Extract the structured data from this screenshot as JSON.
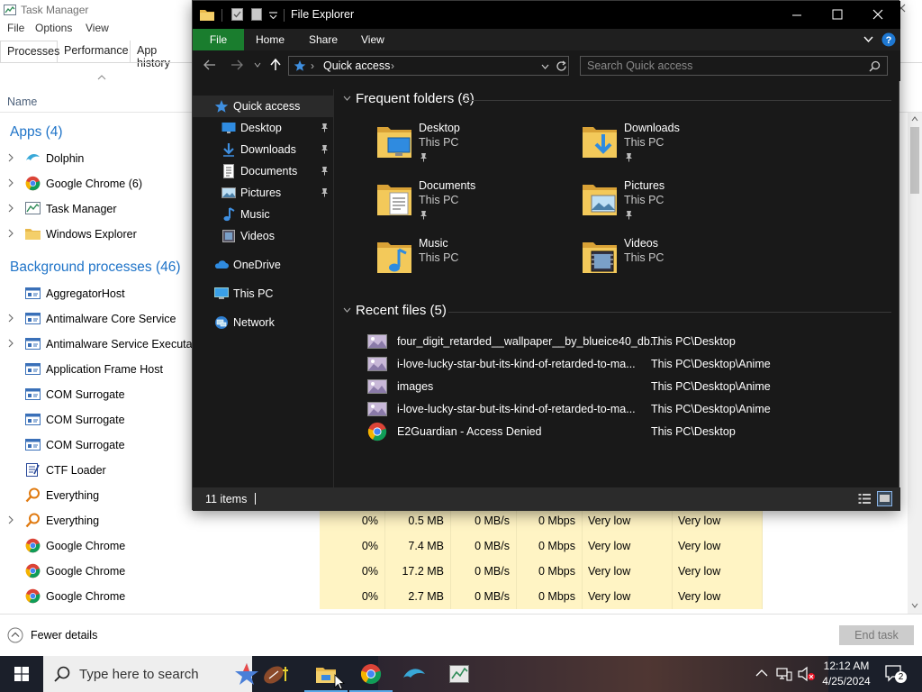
{
  "task_manager": {
    "title": "Task Manager",
    "menu": [
      "File",
      "Options",
      "View"
    ],
    "tabs": [
      "Processes",
      "Performance",
      "App history"
    ],
    "name_column": "Name",
    "apps_heading": "Apps (4)",
    "apps": [
      {
        "name": "Dolphin",
        "icon": "dolphin-icon",
        "expandable": true
      },
      {
        "name": "Google Chrome (6)",
        "icon": "chrome-icon",
        "expandable": true
      },
      {
        "name": "Task Manager",
        "icon": "task-manager-icon",
        "expandable": true
      },
      {
        "name": "Windows Explorer",
        "icon": "folder-icon",
        "expandable": true
      }
    ],
    "background_heading": "Background processes (46)",
    "background": [
      {
        "name": "AggregatorHost",
        "icon": "service-icon",
        "expandable": false
      },
      {
        "name": "Antimalware Core Service",
        "icon": "service-icon",
        "expandable": true
      },
      {
        "name": "Antimalware Service Executable",
        "icon": "service-icon",
        "expandable": true
      },
      {
        "name": "Application Frame Host",
        "icon": "service-icon",
        "expandable": false
      },
      {
        "name": "COM Surrogate",
        "icon": "service-icon",
        "expandable": false
      },
      {
        "name": "COM Surrogate",
        "icon": "service-icon",
        "expandable": false
      },
      {
        "name": "COM Surrogate",
        "icon": "service-icon",
        "expandable": false
      },
      {
        "name": "CTF Loader",
        "icon": "ctf-icon",
        "expandable": false
      },
      {
        "name": "Everything",
        "icon": "everything-icon",
        "expandable": false
      },
      {
        "name": "Everything",
        "icon": "everything-icon",
        "expandable": true,
        "metrics": [
          "0%",
          "0.5 MB",
          "0 MB/s",
          "0 Mbps",
          "Very low",
          "Very low"
        ]
      },
      {
        "name": "Google Chrome",
        "icon": "chrome-icon",
        "expandable": false,
        "metrics": [
          "0%",
          "7.4 MB",
          "0 MB/s",
          "0 Mbps",
          "Very low",
          "Very low"
        ]
      },
      {
        "name": "Google Chrome",
        "icon": "chrome-icon",
        "expandable": false,
        "metrics": [
          "0%",
          "17.2 MB",
          "0 MB/s",
          "0 Mbps",
          "Very low",
          "Very low"
        ]
      },
      {
        "name": "Google Chrome",
        "icon": "chrome-icon",
        "expandable": false,
        "metrics": [
          "0%",
          "2.7 MB",
          "0 MB/s",
          "0 Mbps",
          "Very low",
          "Very low"
        ]
      }
    ],
    "fewer_details": "Fewer details",
    "end_task": "End task"
  },
  "explorer": {
    "title": "File Explorer",
    "ribbon_tabs": [
      "File",
      "Home",
      "Share",
      "View"
    ],
    "address": "Quick access",
    "search_placeholder": "Search Quick access",
    "nav": [
      {
        "label": "Quick access",
        "icon": "star-icon",
        "pinned": false,
        "indent": 1,
        "selected": true
      },
      {
        "label": "Desktop",
        "icon": "desktop-icon",
        "pinned": true,
        "indent": 2
      },
      {
        "label": "Downloads",
        "icon": "download-icon",
        "pinned": true,
        "indent": 2
      },
      {
        "label": "Documents",
        "icon": "document-icon",
        "pinned": true,
        "indent": 2
      },
      {
        "label": "Pictures",
        "icon": "pictures-icon",
        "pinned": true,
        "indent": 2
      },
      {
        "label": "Music",
        "icon": "music-icon",
        "pinned": false,
        "indent": 2
      },
      {
        "label": "Videos",
        "icon": "videos-icon",
        "pinned": false,
        "indent": 2
      },
      {
        "label": "OneDrive",
        "icon": "cloud-icon",
        "pinned": false,
        "indent": 1
      },
      {
        "label": "This PC",
        "icon": "computer-icon",
        "pinned": false,
        "indent": 1
      },
      {
        "label": "Network",
        "icon": "network-icon",
        "pinned": false,
        "indent": 1
      }
    ],
    "frequent_heading": "Frequent folders (6)",
    "folders": [
      {
        "name": "Desktop",
        "location": "This PC",
        "pinned": true,
        "icon": "desktop-folder-icon"
      },
      {
        "name": "Downloads",
        "location": "This PC",
        "pinned": true,
        "icon": "downloads-folder-icon"
      },
      {
        "name": "Documents",
        "location": "This PC",
        "pinned": true,
        "icon": "documents-folder-icon"
      },
      {
        "name": "Pictures",
        "location": "This PC",
        "pinned": true,
        "icon": "pictures-folder-icon"
      },
      {
        "name": "Music",
        "location": "This PC",
        "pinned": false,
        "icon": "music-folder-icon"
      },
      {
        "name": "Videos",
        "location": "This PC",
        "pinned": false,
        "icon": "videos-folder-icon"
      }
    ],
    "recent_heading": "Recent files (5)",
    "recent": [
      {
        "name": "four_digit_retarded__wallpaper__by_blueice40_db...",
        "path": "This PC\\Desktop",
        "icon": "image-file-icon"
      },
      {
        "name": "i-love-lucky-star-but-its-kind-of-retarded-to-ma...",
        "path": "This PC\\Desktop\\Anime",
        "icon": "image-file-icon"
      },
      {
        "name": "images",
        "path": "This PC\\Desktop\\Anime",
        "icon": "image-file-icon"
      },
      {
        "name": "i-love-lucky-star-but-its-kind-of-retarded-to-ma...",
        "path": "This PC\\Desktop\\Anime",
        "icon": "image-file-icon"
      },
      {
        "name": "E2Guardian - Access Denied",
        "path": "This PC\\Desktop",
        "icon": "chrome-icon"
      }
    ],
    "status": "11 items"
  },
  "taskbar": {
    "search_placeholder": "Type here to search",
    "time": "12:12 AM",
    "date": "4/25/2024",
    "notification_count": "2"
  },
  "colors": {
    "explorer_bg": "#191919",
    "ribbon_file": "#1a7d2e",
    "tm_accent": "#1e73c8",
    "metric_bg": "#fff4c4"
  }
}
